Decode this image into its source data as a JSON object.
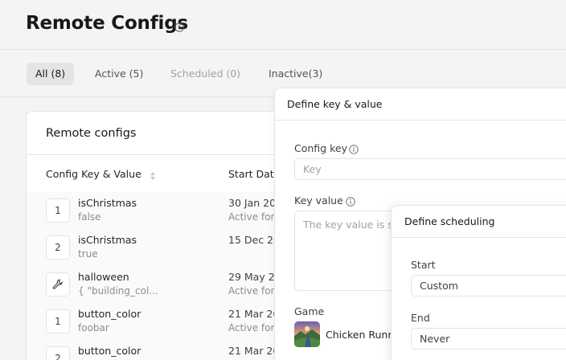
{
  "header": {
    "title": "Remote Configs",
    "info_icon": "info-icon"
  },
  "tabs": [
    {
      "label": "All (8)",
      "state": "selected"
    },
    {
      "label": "Active (5)",
      "state": "normal"
    },
    {
      "label": "Scheduled (0)",
      "state": "disabled"
    },
    {
      "label": "Inactive(3)",
      "state": "normal"
    }
  ],
  "card": {
    "title": "Remote configs",
    "columns": [
      "Config Key & Value",
      "Start Dat"
    ],
    "sort_icon": "sort-icon",
    "rows": [
      {
        "badge": "1",
        "key": "isChristmas",
        "value": "false",
        "date": "30 Jan 20",
        "status": "Active for"
      },
      {
        "badge": "2",
        "key": "isChristmas",
        "value": "true",
        "date": "15 Dec 20",
        "status": ""
      },
      {
        "badge": "wrench-icon",
        "key": "halloween",
        "value": "{ \"building_col...",
        "date": "29 May 20",
        "status": "Active for"
      },
      {
        "badge": "1",
        "key": "button_color",
        "value": "foobar",
        "date": "21 Mar 20",
        "status": "Active for"
      },
      {
        "badge": "2",
        "key": "button_color",
        "value": "",
        "date": "21 Mar 20",
        "status": ""
      }
    ]
  },
  "panel_key_value": {
    "title": "Define key & value",
    "config_key_label": "Config key",
    "config_key_placeholder": "Key",
    "key_value_label": "Key value",
    "key_value_placeholder": "The key value is s",
    "game_label": "Game",
    "game_name": "Chicken Runn"
  },
  "panel_scheduling": {
    "title": "Define scheduling",
    "start_label": "Start",
    "start_value": "Custom",
    "end_label": "End",
    "end_value": "Never"
  },
  "colors": {
    "background": "#f4f4f5",
    "card": "#ffffff",
    "border": "#e4e4e7",
    "selected_tab": "#e4e4e7",
    "muted_text": "#8b8b93"
  }
}
